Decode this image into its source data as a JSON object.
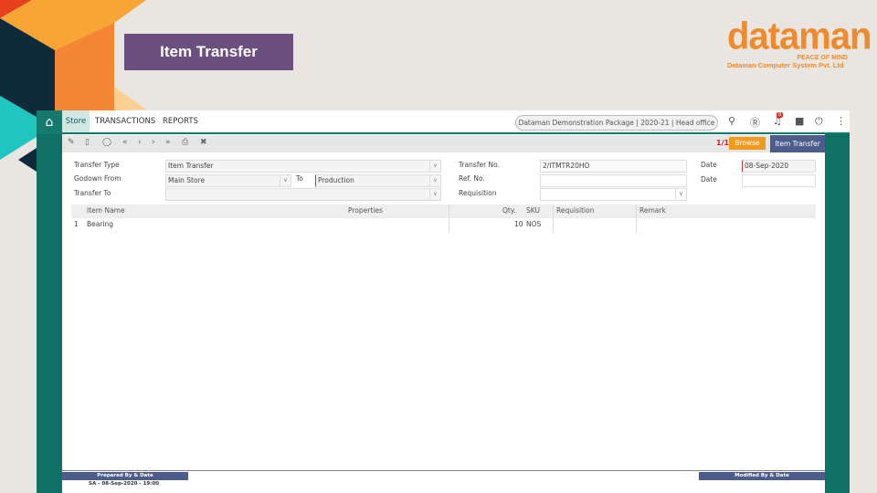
{
  "banner": {
    "title": "Item Transfer"
  },
  "logo": {
    "brand": "dataman",
    "tagline": "PEACE OF MIND",
    "company": "Dataman Computer System Pvt. Ltd"
  },
  "nav": {
    "items": [
      "Store",
      "TRANSACTIONS",
      "REPORTS"
    ],
    "context": "Dataman Demonstration Package | 2020-21 | Head office",
    "notifications": "0"
  },
  "toolbar": {
    "record_count": "1/1",
    "browse": "Browse",
    "mode": "Item Transfer"
  },
  "form": {
    "transfer_type_label": "Transfer Type",
    "transfer_type": "Item Transfer",
    "godown_from_label": "Godown From",
    "godown_from": "Main Store",
    "to_label": "To",
    "to": "Production",
    "transfer_to_label": "Transfer To",
    "transfer_to": "",
    "transfer_no_label": "Transfer No.",
    "transfer_no": "2/ITMTR20HO",
    "ref_no_label": "Ref. No.",
    "ref_no": "",
    "requisition_label": "Requisition",
    "requisition": "",
    "date_label": "Date",
    "date": "08-Sep-2020",
    "ref_date_label": "Date",
    "ref_date": ""
  },
  "grid": {
    "columns": [
      "Item Name",
      "Properties",
      "Qty.",
      "SKU",
      "Requisition",
      "Remark"
    ],
    "rows": [
      {
        "no": "1",
        "item": "Bearing",
        "properties": "",
        "qty": "10",
        "sku": "NOS",
        "requisition": "",
        "remark": ""
      }
    ]
  },
  "footer": {
    "prepared_label": "Prepared By & Date",
    "prepared_value": "SA - 08-Sep-2020 - 19:00",
    "modified_label": "Modified By & Date"
  },
  "colors": {
    "teal": "#0e7164",
    "banner": "#6b4f7e",
    "accent": "#f39a1e",
    "navy": "#4c5d8c"
  }
}
